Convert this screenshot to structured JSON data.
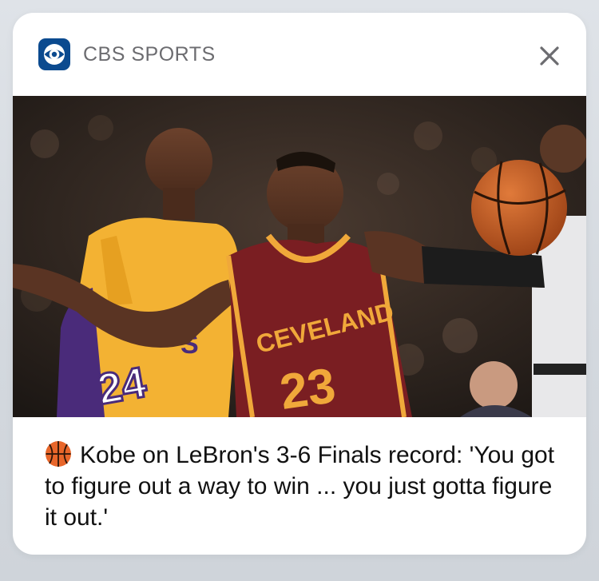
{
  "notification": {
    "app_name": "CBS SPORTS",
    "app_icon": "cbs-eye-icon",
    "close_icon": "close-icon",
    "emoji_icon": "basketball-icon",
    "headline": "Kobe on LeBron's 3-6 Finals record: 'You got to figure out a way to win ... you just gotta figure it out.'",
    "photo": {
      "left_jersey_text": "S",
      "left_jersey_number": "24",
      "right_jersey_text": "CEVELAND",
      "right_jersey_number": "23"
    }
  },
  "colors": {
    "card_background": "#ffffff",
    "app_icon_background": "#0b4a8f",
    "cavaliers_wine": "#7a1e22",
    "cavaliers_gold": "#f0a83a",
    "lakers_gold": "#f3b233",
    "lakers_purple": "#4a2b7a"
  }
}
